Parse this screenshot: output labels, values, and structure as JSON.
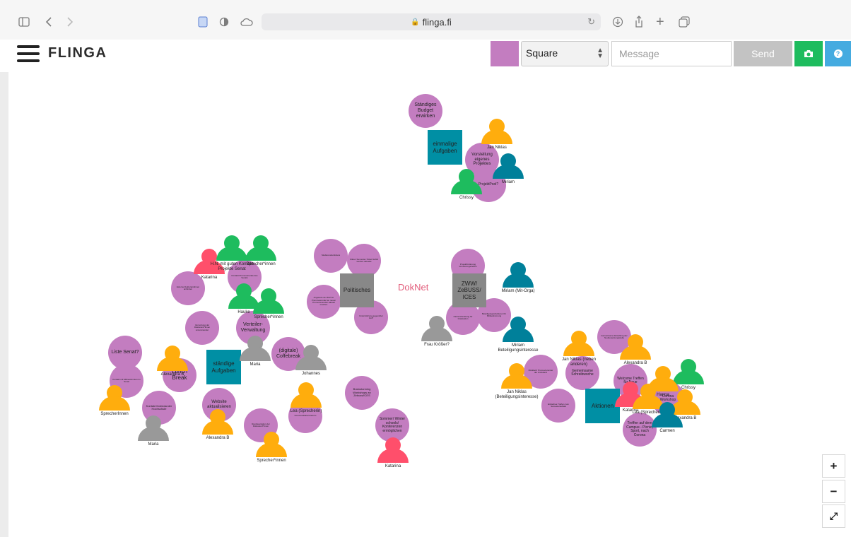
{
  "browser": {
    "url": "flinga.fi"
  },
  "app": {
    "logo": "FLINGA",
    "shape_selected": "Square",
    "message_placeholder": "Message",
    "send_label": "Send"
  },
  "colors": {
    "note": "#c37dc0",
    "teal": "#008fa4",
    "gray_square": "#888888",
    "orange": "#ffad0d",
    "green": "#1ebc5e",
    "pink": "#ff4f6b",
    "blue_person": "#00809a",
    "gray_person": "#999999"
  },
  "board": {
    "center": "DokNet",
    "notes": [
      {
        "text": "Ständiges Budget erwirken"
      },
      {
        "text": "Vorstellung eigenes Projektes"
      },
      {
        "text": "ProjektPool?"
      },
      {
        "text": "Studierendentickets"
      },
      {
        "text": "Klären Semester-Ticket Nahtlt werden aktuelle"
      },
      {
        "text": "Angebote der ZLP für Promovierende bei neuen Promovierenden aktuell machen"
      },
      {
        "text": "Unterstützung gegenüber HoP"
      },
      {
        "text": "Projektförderung Vernetzungstreffen"
      },
      {
        "text": "Kontakt Promovierende des Senats"
      },
      {
        "text": "Externe Doktorandinnen anbinden"
      },
      {
        "text": "Vernetzung der Doktorand*innen untereinander"
      },
      {
        "text": "Verteiler-Verwaltung"
      },
      {
        "text": "(digitale) Coffebreak"
      },
      {
        "text": "Liste Senat?"
      },
      {
        "text": "Kontakt mit Mitbestimmten im Senat"
      },
      {
        "text": "Lunch Break"
      },
      {
        "text": "Kontakt Doktorander Hochschule"
      },
      {
        "text": "Website aktualisieren"
      },
      {
        "text": "Repräsentation der Doktorand*innen"
      },
      {
        "text": "Kommunikationsreform"
      },
      {
        "text": "Brainstorming Workshops an Zebuss/ICES"
      },
      {
        "text": "Sommer/ Winter schools/ Konferenzen ermöglichen"
      },
      {
        "text": "Karriereberatung für Graduation"
      },
      {
        "text": "Beteiligungsstrukturen für Mitbestimmung"
      },
      {
        "text": "Rückkehr Promovierender der Ambulanz"
      },
      {
        "text": "Gemeinsame Schreibwoche"
      },
      {
        "text": "Gemeinsame Erstellung der Neubewertungsstelle"
      },
      {
        "text": "Welcome Treffen für Neue"
      },
      {
        "text": "Corona Workshop"
      },
      {
        "text": "Einfaches Treffen zum Semesterauftakt"
      },
      {
        "text": "Treffen auf dem Campus - Picnic, Sport, nach Corona"
      }
    ],
    "squares": [
      {
        "text": "einmalige Aufgaben"
      },
      {
        "text": "Politisches"
      },
      {
        "text": "ZWW/ ZeBUSS/ ICES"
      },
      {
        "text": "ständige Aufgaben"
      },
      {
        "text": "Aktionen"
      }
    ],
    "people": [
      {
        "name": "Jan Niklas"
      },
      {
        "name": "Miriam"
      },
      {
        "name": "Chrissy"
      },
      {
        "name": "Katarina"
      },
      {
        "name": "H.N. mit guten Kontakt Projekte Senat"
      },
      {
        "name": "Sprecher*innen"
      },
      {
        "name": "Hauke"
      },
      {
        "name": "Sprecher*innen"
      },
      {
        "name": "Miriam (Mit-Orga)"
      },
      {
        "name": "Frau Krößer?"
      },
      {
        "name": "Miriam Beteiligungsinteresse"
      },
      {
        "name": "Maria"
      },
      {
        "name": "Johannes"
      },
      {
        "name": "Alexandra B"
      },
      {
        "name": "SprecherInnen"
      },
      {
        "name": "Maria"
      },
      {
        "name": "Alexandra B"
      },
      {
        "name": "Lea (Sprecherin)"
      },
      {
        "name": "Sprecher*innen"
      },
      {
        "name": "Katarina"
      },
      {
        "name": "Jan Niklas (neben anderen)"
      },
      {
        "name": "Jan Niklas (Beteiligungsinteresse)"
      },
      {
        "name": "Alexandra B"
      },
      {
        "name": "Chrissy"
      },
      {
        "name": "Katarina"
      },
      {
        "name": "Lea (Sprecherin)"
      },
      {
        "name": "Hanna"
      },
      {
        "name": "Alexandra B"
      },
      {
        "name": "Carmen"
      }
    ]
  },
  "zoom": {
    "in": "+",
    "out": "−",
    "fit": "⤢"
  }
}
